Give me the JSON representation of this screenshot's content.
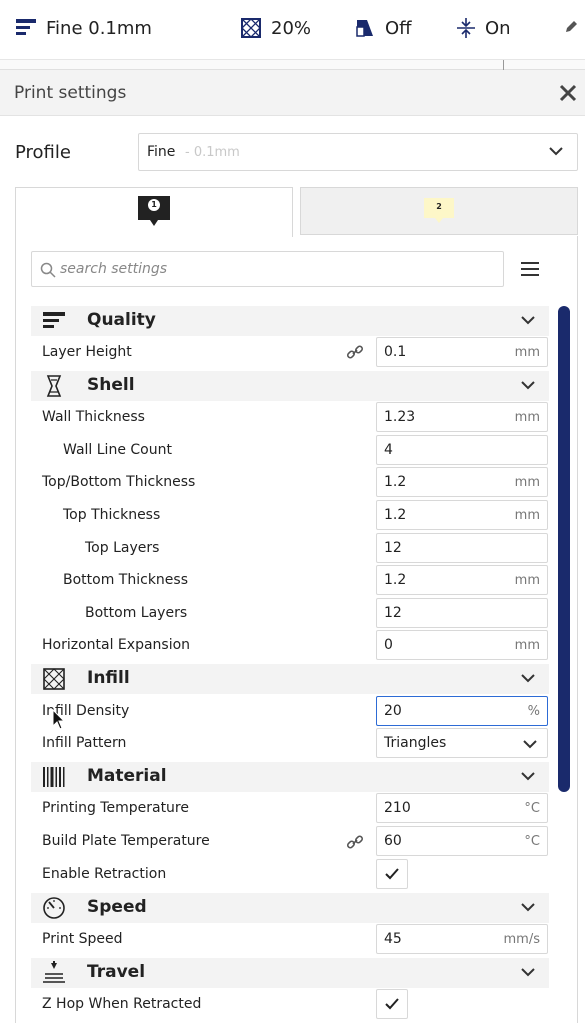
{
  "toolbar": {
    "profile_label": "Fine 0.1mm",
    "infill_label": "20%",
    "support_label": "Off",
    "adhesion_label": "On",
    "icons": [
      "quality-icon",
      "infill-icon",
      "support-icon",
      "adhesion-icon",
      "pencil-icon"
    ]
  },
  "panel": {
    "title": "Print settings"
  },
  "profile": {
    "label": "Profile",
    "name": "Fine",
    "subtitle": "- 0.1mm"
  },
  "extruders": {
    "tab1": "1",
    "tab2": "2",
    "tab2_color": "#fdf7c8"
  },
  "search": {
    "placeholder": "search settings"
  },
  "categories": {
    "quality": "Quality",
    "shell": "Shell",
    "infill": "Infill",
    "material": "Material",
    "speed": "Speed",
    "travel": "Travel"
  },
  "settings": {
    "layer_height": {
      "label": "Layer Height",
      "value": "0.1",
      "unit": "mm"
    },
    "wall_thickness": {
      "label": "Wall Thickness",
      "value": "1.23",
      "unit": "mm"
    },
    "wall_line_count": {
      "label": "Wall Line Count",
      "value": "4"
    },
    "top_bottom_thickness": {
      "label": "Top/Bottom Thickness",
      "value": "1.2",
      "unit": "mm"
    },
    "top_thickness": {
      "label": "Top Thickness",
      "value": "1.2",
      "unit": "mm"
    },
    "top_layers": {
      "label": "Top Layers",
      "value": "12"
    },
    "bottom_thickness": {
      "label": "Bottom Thickness",
      "value": "1.2",
      "unit": "mm"
    },
    "bottom_layers": {
      "label": "Bottom Layers",
      "value": "12"
    },
    "horizontal_expansion": {
      "label": "Horizontal Expansion",
      "value": "0",
      "unit": "mm"
    },
    "infill_density": {
      "label": "Infill Density",
      "value": "20",
      "unit": "%"
    },
    "infill_pattern": {
      "label": "Infill Pattern",
      "value": "Triangles"
    },
    "printing_temperature": {
      "label": "Printing Temperature",
      "value": "210",
      "unit": "°C"
    },
    "build_plate_temperature": {
      "label": "Build Plate Temperature",
      "value": "60",
      "unit": "°C"
    },
    "enable_retraction": {
      "label": "Enable Retraction",
      "checked": true
    },
    "print_speed": {
      "label": "Print Speed",
      "value": "45",
      "unit": "mm/s"
    },
    "z_hop": {
      "label": "Z Hop When Retracted",
      "checked": true
    }
  },
  "colors": {
    "accent": "#1a2a6c",
    "focus": "#2d6bd5"
  }
}
